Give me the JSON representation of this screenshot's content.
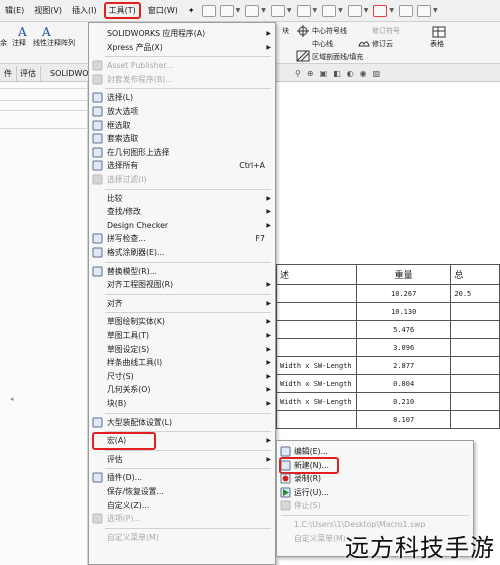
{
  "menubar": {
    "items": [
      "辑(E)",
      "视图(V)",
      "插入(I)",
      "工具(T)",
      "窗口(W)"
    ],
    "pin_icon": "pin-icon"
  },
  "ribbon": {
    "left_labels": [
      "余",
      "注释",
      "线性注释阵列"
    ],
    "right_top": [
      "中心符号线",
      "修订符号"
    ],
    "right_mid": [
      "中心线",
      "修订云"
    ],
    "right_bottom": "区域剖面线/填充",
    "col_block": "块",
    "col_table": "表格"
  },
  "tabs": [
    "件",
    "评估",
    "SOLIDWO"
  ],
  "menu": {
    "items": [
      {
        "label": "SOLIDWORKS 应用程序(A)",
        "arrow": true
      },
      {
        "label": "Xpress 产品(X)",
        "arrow": true
      },
      {
        "sep": true
      },
      {
        "label": "Asset Publisher...",
        "disabled": true
      },
      {
        "label": "封套发布程序(B)...",
        "disabled": true
      },
      {
        "sep": true
      },
      {
        "label": "选择(L)"
      },
      {
        "label": "放大选项"
      },
      {
        "label": "框选取"
      },
      {
        "label": "套索选取"
      },
      {
        "label": "在几何图形上选择"
      },
      {
        "label": "选择所有",
        "shortcut": "Ctrl+A"
      },
      {
        "label": "选择过滤(I)",
        "disabled": true
      },
      {
        "sep": true
      },
      {
        "label": "比较",
        "arrow": true
      },
      {
        "label": "查找/修改",
        "arrow": true
      },
      {
        "label": "Design Checker",
        "arrow": true
      },
      {
        "label": "拼写检查...",
        "shortcut": "F7"
      },
      {
        "label": "格式涂刷器(E)..."
      },
      {
        "sep": true
      },
      {
        "label": "替换模型(R)..."
      },
      {
        "label": "对齐工程图视图(R)",
        "arrow": true
      },
      {
        "sep": true
      },
      {
        "label": "对齐",
        "arrow": true
      },
      {
        "sep": true
      },
      {
        "label": "草图绘制实体(K)",
        "arrow": true
      },
      {
        "label": "草图工具(T)",
        "arrow": true
      },
      {
        "label": "草图设定(S)",
        "arrow": true
      },
      {
        "label": "样条曲线工具(I)",
        "arrow": true
      },
      {
        "label": "尺寸(S)",
        "arrow": true
      },
      {
        "label": "几何关系(O)",
        "arrow": true
      },
      {
        "label": "块(B)",
        "arrow": true
      },
      {
        "sep": true
      },
      {
        "label": "大型装配体设置(L)"
      },
      {
        "sep": true
      },
      {
        "label": "宏(A)",
        "arrow": true,
        "highlight": true
      },
      {
        "sep": true
      },
      {
        "label": "评估",
        "arrow": true
      },
      {
        "sep": true
      },
      {
        "label": "插件(D)..."
      },
      {
        "label": "保存/恢复设置..."
      },
      {
        "label": "自定义(Z)..."
      },
      {
        "label": "选项(P)...",
        "disabled": true
      },
      {
        "sep": true
      },
      {
        "label": "自定义菜单(M)",
        "disabled": true
      }
    ]
  },
  "submenu": {
    "items": [
      {
        "label": "编辑(E)..."
      },
      {
        "label": "新建(N)...",
        "highlight": true
      },
      {
        "label": "录制(R)"
      },
      {
        "label": "运行(U)..."
      },
      {
        "label": "停止(S)",
        "disabled": true
      },
      {
        "sep": true
      },
      {
        "label": "1.C:\\Users\\1\\Desktop\\Macro1.swp",
        "disabled": true
      },
      {
        "label": "自定义菜单(M)",
        "disabled": true
      }
    ]
  },
  "bom": {
    "header": [
      "述",
      "重量",
      "总"
    ],
    "rows": [
      [
        "",
        "10.267",
        "20.5"
      ],
      [
        "",
        "10.130",
        ""
      ],
      [
        "",
        "5.476",
        ""
      ],
      [
        "",
        "3.096",
        ""
      ],
      [
        "Width x SW-Length",
        "2.877",
        ""
      ],
      [
        "Width x SW-Length",
        "0.804",
        ""
      ],
      [
        "Width x SW-Length",
        "0.210",
        ""
      ],
      [
        "",
        "8.107",
        ""
      ]
    ]
  },
  "watermark": "远方科技手游",
  "colors": {
    "highlight": "#e02020",
    "menu_bg": "#f7f7f7",
    "selection": "#d9e6f6"
  }
}
